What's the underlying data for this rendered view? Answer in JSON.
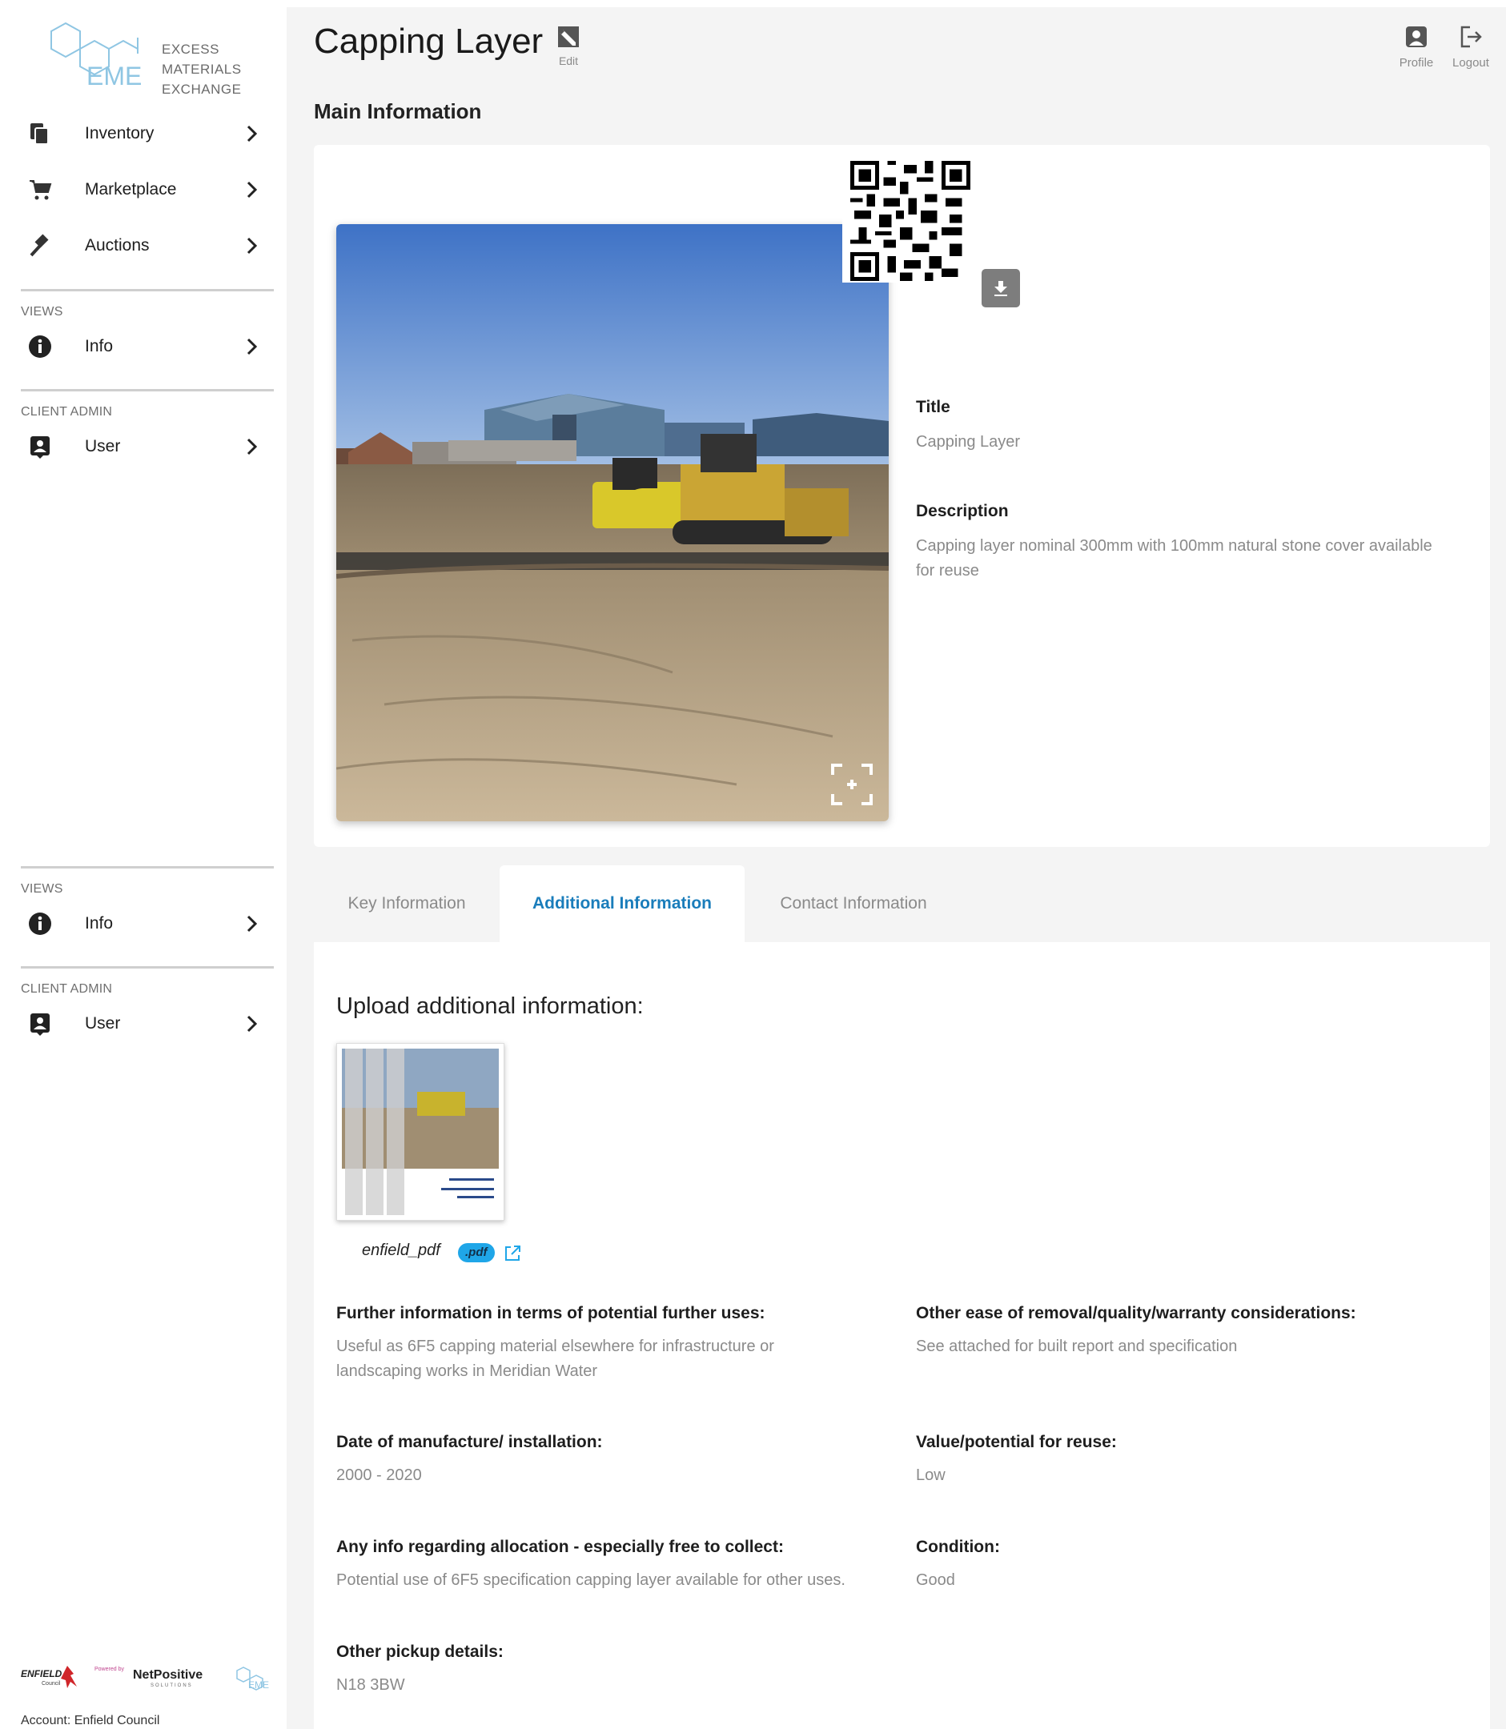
{
  "brand": {
    "logo_letters": "EME",
    "logo_lines": [
      "EXCESS",
      "MATERIALS",
      "EXCHANGE"
    ]
  },
  "sidebar": {
    "items": [
      {
        "label": "Inventory",
        "icon": "inventory-icon"
      },
      {
        "label": "Marketplace",
        "icon": "cart-icon"
      },
      {
        "label": "Auctions",
        "icon": "gavel-icon"
      }
    ],
    "sections": [
      {
        "title": "VIEWS",
        "item": {
          "label": "Info",
          "icon": "info-icon"
        }
      },
      {
        "title": "CLIENT ADMIN",
        "item": {
          "label": "User",
          "icon": "user-badge-icon"
        }
      },
      {
        "title": "VIEWS",
        "item": {
          "label": "Info",
          "icon": "info-icon"
        }
      },
      {
        "title": "CLIENT ADMIN",
        "item": {
          "label": "User",
          "icon": "user-badge-icon"
        }
      }
    ],
    "sponsors": {
      "council": "ENFIELD",
      "council_sub": "Council",
      "powered": "Powered by",
      "partner": "NetPositive",
      "partner_sub": "SOLUTIONS"
    },
    "account": "Account: Enfield Council"
  },
  "header": {
    "title": "Capping Layer",
    "edit_label": "Edit",
    "profile_label": "Profile",
    "logout_label": "Logout"
  },
  "main_info": {
    "section_title": "Main Information",
    "title_label": "Title",
    "title_value": "Capping Layer",
    "description_label": "Description",
    "description_line1": "Capping layer nominal 300mm with 100mm natural stone cover available",
    "description_line2": "for reuse"
  },
  "tabs": [
    {
      "label": "Key Information",
      "active": false
    },
    {
      "label": "Additional Information",
      "active": true
    },
    {
      "label": "Contact Information",
      "active": false
    }
  ],
  "additional": {
    "upload_title": "Upload additional information:",
    "doc_name": "enfield_pdf",
    "doc_ext": ".pdf",
    "fields": {
      "further_uses_label": "Further information in terms of potential further uses:",
      "further_uses_line1": "Useful as 6F5 capping material elsewhere for infrastructure or",
      "further_uses_line2": "landscaping works in Meridian Water",
      "removal_label": "Other ease of removal/quality/warranty considerations:",
      "removal_value": "See attached for built report and specification",
      "date_label": "Date of manufacture/ installation:",
      "date_value": "2000 - 2020",
      "value_label": "Value/potential for reuse:",
      "value_value": "Low",
      "allocation_label": "Any info regarding allocation - especially free to collect:",
      "allocation_value": "Potential use of 6F5 specification capping layer available for other uses.",
      "condition_label": "Condition:",
      "condition_value": "Good",
      "pickup_label": "Other pickup details:",
      "pickup_value": "N18 3BW"
    }
  },
  "colors": {
    "accent": "#1a7dbb",
    "pdf_badge": "#1fa6e8",
    "logo": "#8fc6e3",
    "muted_text": "#8a8a8a"
  }
}
